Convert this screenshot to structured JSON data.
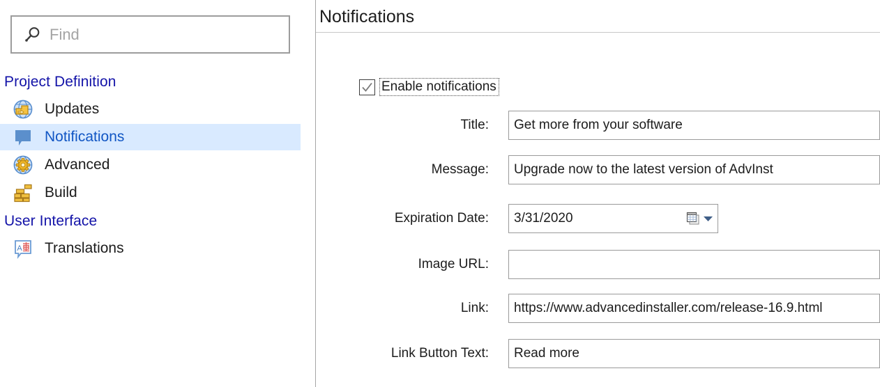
{
  "search": {
    "placeholder": "Find",
    "value": "",
    "icon": "search-icon"
  },
  "sidebar": {
    "groups": [
      {
        "label": "Project Definition",
        "items": [
          {
            "label": "Updates",
            "icon": "globe-arrow-icon",
            "selected": false
          },
          {
            "label": "Notifications",
            "icon": "speech-bubble-icon",
            "selected": true
          },
          {
            "label": "Advanced",
            "icon": "globe-gear-icon",
            "selected": false
          },
          {
            "label": "Build",
            "icon": "brick-wall-icon",
            "selected": false
          }
        ]
      },
      {
        "label": "User Interface",
        "items": [
          {
            "label": "Translations",
            "icon": "translation-bubble-icon",
            "selected": false
          }
        ]
      }
    ]
  },
  "page": {
    "title": "Notifications"
  },
  "form": {
    "enable": {
      "label": "Enable notifications",
      "checked": true
    },
    "fields": [
      {
        "label": "Title:",
        "value": "Get more from your software"
      },
      {
        "label": "Message:",
        "value": "Upgrade now to the latest version of AdvInst"
      },
      {
        "label": "Expiration Date:",
        "value": "3/31/2020"
      },
      {
        "label": "Image URL:",
        "value": ""
      },
      {
        "label": "Link:",
        "value": "https://www.advancedinstaller.com/release-16.9.html"
      },
      {
        "label": "Link Button Text:",
        "value": "Read more"
      }
    ],
    "date_picker": {
      "calendar_icon": "calendar-icon",
      "dropdown_icon": "chevron-down-icon"
    }
  },
  "colors": {
    "selection": "#d9eaff",
    "group_header": "#1313a8",
    "selected_text": "#1156c4",
    "border": "#9a9a9a"
  }
}
